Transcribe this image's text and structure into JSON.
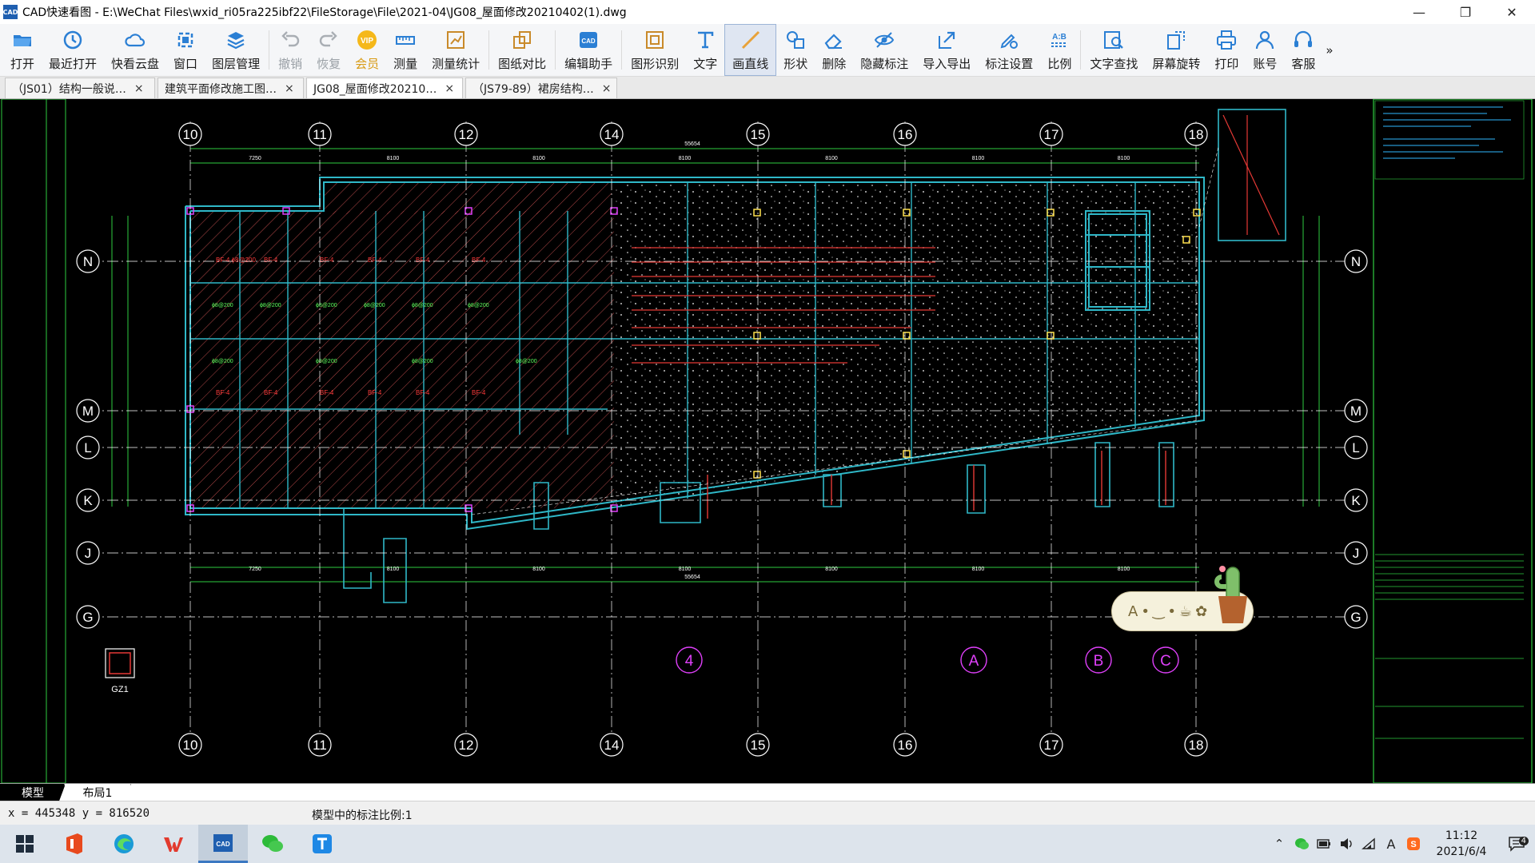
{
  "window": {
    "app_icon_text": "CAD",
    "title": "CAD快速看图 - E:\\WeChat Files\\wxid_ri05ra225ibf22\\FileStorage\\File\\2021-04\\JG08_屋面修改20210402(1).dwg"
  },
  "toolbar": {
    "items": [
      {
        "label": "打开",
        "icon": "folder-open-icon"
      },
      {
        "label": "最近打开",
        "icon": "recent-clock-icon"
      },
      {
        "label": "快看云盘",
        "icon": "cloud-icon"
      },
      {
        "label": "窗口",
        "icon": "window-icon"
      },
      {
        "label": "图层管理",
        "icon": "layers-icon"
      },
      {
        "label": "撤销",
        "icon": "undo-icon"
      },
      {
        "label": "恢复",
        "icon": "redo-icon"
      },
      {
        "label": "会员",
        "icon": "vip-icon",
        "badge": "VIP"
      },
      {
        "label": "测量",
        "icon": "ruler-icon"
      },
      {
        "label": "测量统计",
        "icon": "measure-stats-icon"
      },
      {
        "label": "图纸对比",
        "icon": "compare-icon"
      },
      {
        "label": "编辑助手",
        "icon": "edit-assistant-icon"
      },
      {
        "label": "图形识别",
        "icon": "shape-recognize-icon"
      },
      {
        "label": "文字",
        "icon": "text-icon"
      },
      {
        "label": "画直线",
        "icon": "line-icon"
      },
      {
        "label": "形状",
        "icon": "shape-icon"
      },
      {
        "label": "删除",
        "icon": "eraser-icon"
      },
      {
        "label": "隐藏标注",
        "icon": "hide-annotation-icon"
      },
      {
        "label": "导入导出",
        "icon": "import-export-icon"
      },
      {
        "label": "标注设置",
        "icon": "annotation-settings-icon"
      },
      {
        "label": "比例",
        "icon": "scale-icon",
        "badge": "A:B"
      },
      {
        "label": "文字查找",
        "icon": "text-search-icon"
      },
      {
        "label": "屏幕旋转",
        "icon": "rotate-screen-icon"
      },
      {
        "label": "打印",
        "icon": "printer-icon"
      },
      {
        "label": "账号",
        "icon": "user-icon"
      },
      {
        "label": "客服",
        "icon": "headset-icon"
      }
    ],
    "overflow": "»"
  },
  "tabs": [
    {
      "label": "（JS01）结构一般说…"
    },
    {
      "label": "建筑平面修改施工图…"
    },
    {
      "label": "JG08_屋面修改20210…"
    },
    {
      "label": "（JS79-89）裙房结构…"
    }
  ],
  "tab_close": "×",
  "drawing": {
    "axis_top_labels": [
      "10",
      "11",
      "12",
      "14",
      "15",
      "16",
      "17",
      "18"
    ],
    "axis_side_labels": [
      "N",
      "M",
      "L",
      "K",
      "J",
      "G"
    ],
    "section_labels": [
      "4",
      "A",
      "B",
      "C"
    ],
    "column_tag": "GZ1",
    "total_dim": "55654",
    "span_dims": [
      "7250",
      "8100",
      "8100",
      "8100",
      "8100",
      "8100",
      "8100"
    ]
  },
  "model_tabs": {
    "model": "模型",
    "layout": "布局1"
  },
  "status": {
    "coords": "x = 445348  y = 816520",
    "scale_text": "模型中的标注比例:1"
  },
  "float_widget": {
    "text": "A•‿•☕✿"
  },
  "taskbar": {
    "apps": [
      "office-icon",
      "edge-icon",
      "wps-icon",
      "cad-viewer-icon",
      "wechat-icon",
      "text-app-icon"
    ],
    "clock_time": "11:12",
    "clock_date": "2021/6/4",
    "ime": "A",
    "notification_count": "4"
  }
}
